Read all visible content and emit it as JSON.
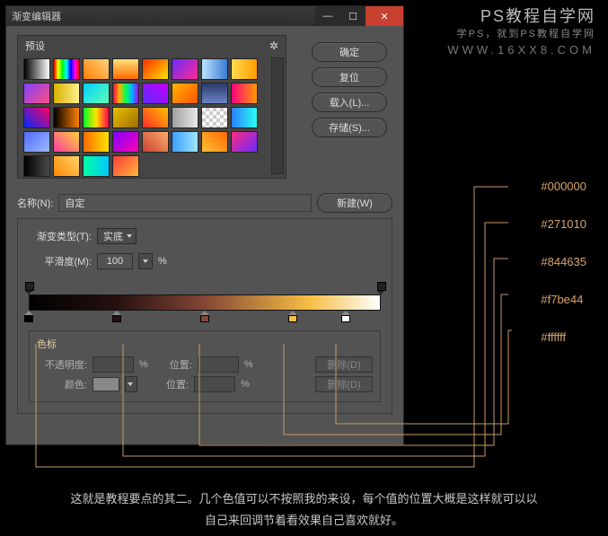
{
  "window": {
    "title": "渐变编辑器",
    "minimize_label": "—",
    "maximize_label": "☐",
    "close_label": "✕"
  },
  "presets": {
    "header": "预设",
    "gear_icon": "✲"
  },
  "buttons": {
    "ok": "确定",
    "reset": "复位",
    "load": "载入(L)...",
    "save": "存储(S)...",
    "new": "新建(W)"
  },
  "name": {
    "label": "名称(N):",
    "value": "自定"
  },
  "gradient": {
    "type_label": "渐变类型(T):",
    "type_value": "实底",
    "smooth_label": "平滑度(M):",
    "smooth_value": "100",
    "smooth_unit": "%"
  },
  "stops_panel": {
    "title": "色标",
    "opacity_label": "不透明度:",
    "opacity_unit": "%",
    "position_label": "位置:",
    "position_unit": "%",
    "color_label": "颜色:",
    "delete_label": "删除(D)"
  },
  "color_stops": [
    {
      "pos": 0,
      "color": "#000000"
    },
    {
      "pos": 25,
      "color": "#271010"
    },
    {
      "pos": 50,
      "color": "#844635"
    },
    {
      "pos": 75,
      "color": "#f7be44"
    },
    {
      "pos": 90,
      "color": "#ffffff"
    }
  ],
  "opacity_stops": [
    {
      "pos": 0
    },
    {
      "pos": 100
    }
  ],
  "annotations": {
    "c0": "#000000",
    "c1": "#271010",
    "c2": "#844635",
    "c3": "#f7be44",
    "c4": "#ffffff"
  },
  "watermark": {
    "line1": "PS教程自学网",
    "line2": "学PS，就到PS教程自学网",
    "line3": "WWW.16XX8.COM"
  },
  "caption": {
    "line1": "这就是教程要点的其二。几个色值可以不按照我的来设，每个值的位置大概是这样就可以以",
    "line2": "自己来回调节着看效果自己喜欢就好。"
  },
  "preset_thumbs": [
    "linear-gradient(90deg,#000,#fff)",
    "linear-gradient(90deg,#f00,#ff0,#0f0,#0ff,#00f,#f0f,#f00)",
    "linear-gradient(45deg,#ff7f00,#ffd27f)",
    "linear-gradient(180deg,#ffe07a,#ff6b00)",
    "linear-gradient(135deg,#ff2a00,#ffe400)",
    "linear-gradient(135deg,#6c2aff,#ff2a90)",
    "linear-gradient(90deg,#bde3ff,#3a7bd5)",
    "linear-gradient(90deg,#ffdb4d,#ff9c00)",
    "linear-gradient(135deg,#7f3fff,#ff4f7f)",
    "linear-gradient(90deg,#d9b200,#ffef8a)",
    "linear-gradient(135deg,#00d0ff,#5fffb1)",
    "linear-gradient(90deg,#ff004c,#ffb300,#00ff55,#00b3ff,#aa00ff)",
    "linear-gradient(45deg,#5b2aff,#c600ff)",
    "linear-gradient(135deg,#ffb400,#ff5400)",
    "linear-gradient(180deg,#2a3a6b,#6b83c4)",
    "linear-gradient(90deg,#ff007f,#ff9a00)",
    "linear-gradient(45deg,#002aff,#ff005c)",
    "linear-gradient(90deg,#000,#ff7f00)",
    "linear-gradient(90deg,#00ff26,#ffe400,#ff004d)",
    "linear-gradient(135deg,#e6c200,#a06a00)",
    "linear-gradient(45deg,#ff2a2a,#ffc400)",
    "linear-gradient(90deg,#a0a0a0,#e8e8e8)",
    "repeating-conic-gradient(#ccc 0 25%,#fff 0 50%)",
    "linear-gradient(90deg,#2a7fff,#2afff0)",
    "linear-gradient(135deg,#4f6dff,#9fb8ff)",
    "linear-gradient(45deg,#ff3aa0,#ffd23a)",
    "linear-gradient(90deg,#ff6a00,#ffe400)",
    "linear-gradient(135deg,#8000ff,#ff00b3)",
    "linear-gradient(45deg,#c84030,#ffae6b)",
    "linear-gradient(90deg,#3aa0ff,#9fe7ff)",
    "linear-gradient(45deg,#ffbf3a,#ff6a00)",
    "linear-gradient(135deg,#ff2a7f,#6a2aff)",
    "linear-gradient(90deg,#000,#4a4a4a)",
    "linear-gradient(45deg,#ff8a00,#ffd36a)",
    "linear-gradient(90deg,#00ffa0,#00c8ff)",
    "linear-gradient(135deg,#ff3a3a,#ffb83a)"
  ]
}
